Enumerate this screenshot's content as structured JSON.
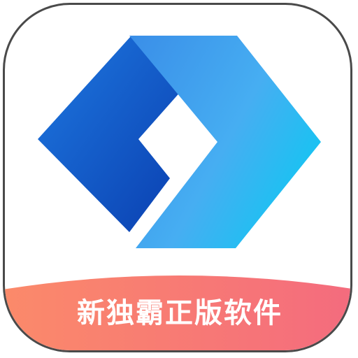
{
  "app_icon": {
    "banner_label": "新独霸正版软件",
    "logo_icon": "launcher-chevron-icon",
    "colors": {
      "left_shape_dark": "#0a3fb0",
      "left_shape_light": "#1e78e0",
      "right_shape_light": "#3fa8f0",
      "right_shape_cyan": "#16c4f2",
      "banner_left": "#fb8a6a",
      "banner_right": "#f46b7e",
      "frame_border": "#4a4a4a"
    }
  }
}
